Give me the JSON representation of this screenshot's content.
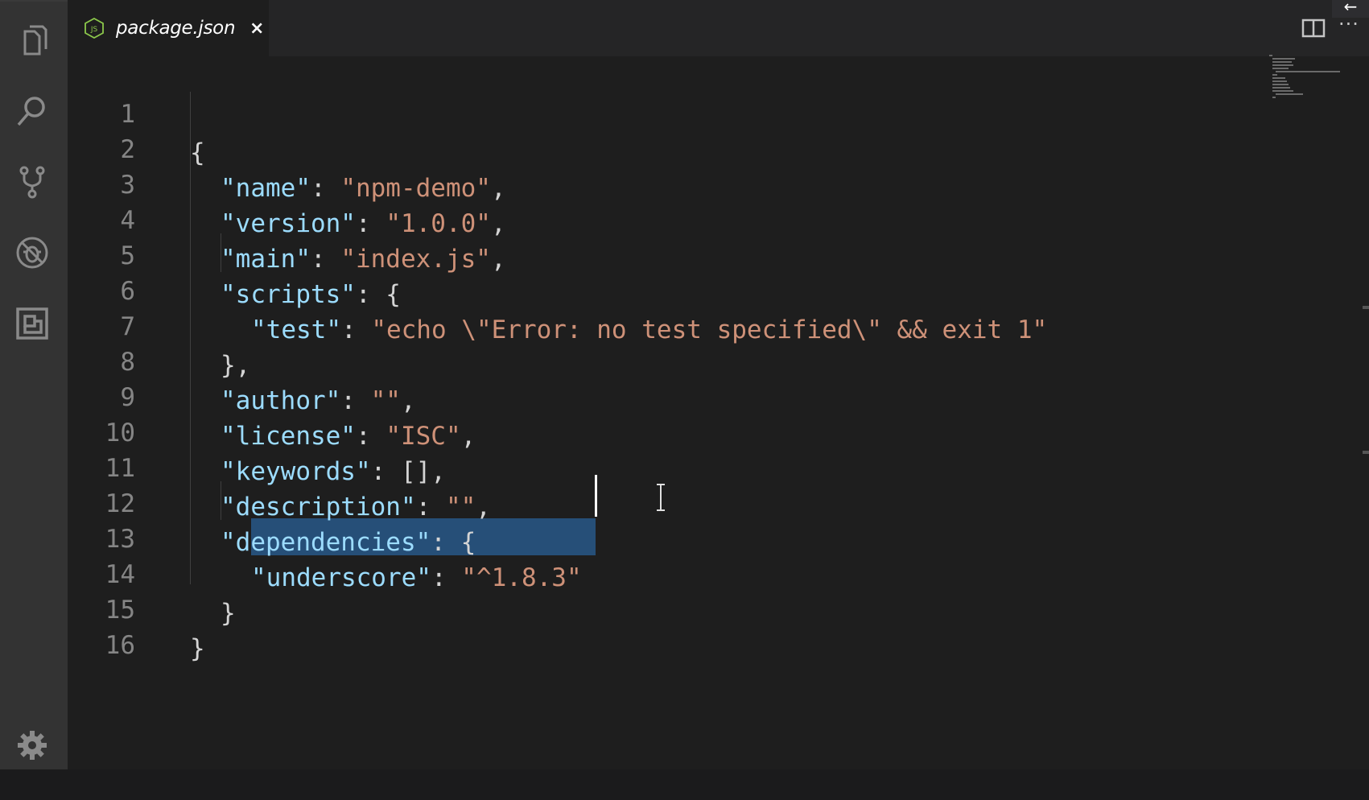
{
  "activity_bar": {
    "icons": [
      "files-icon",
      "search-icon",
      "source-control-icon",
      "debug-icon",
      "extensions-icon",
      "gear-icon"
    ]
  },
  "tab": {
    "label": "package.json",
    "close": "×"
  },
  "editor": {
    "more_actions": "···",
    "back": "←",
    "lines": [
      {
        "n": "1"
      },
      {
        "n": "2"
      },
      {
        "n": "3"
      },
      {
        "n": "4"
      },
      {
        "n": "5"
      },
      {
        "n": "6"
      },
      {
        "n": "7"
      },
      {
        "n": "8"
      },
      {
        "n": "9"
      },
      {
        "n": "10"
      },
      {
        "n": "11"
      },
      {
        "n": "12"
      },
      {
        "n": "13"
      },
      {
        "n": "14"
      },
      {
        "n": "15"
      },
      {
        "n": "16"
      }
    ],
    "tokens": {
      "l1_brace": "{",
      "name_key": "\"name\"",
      "name_val": "\"npm-demo\"",
      "version_key": "\"version\"",
      "version_val": "\"1.0.0\"",
      "main_key": "\"main\"",
      "main_val": "\"index.js\"",
      "scripts_key": "\"scripts\"",
      "test_key": "\"test\"",
      "test_val": "\"echo \\\"Error: no test specified\\\" && exit 1\"",
      "scripts_close": "},",
      "author_key": "\"author\"",
      "author_val": "\"\"",
      "license_key": "\"license\"",
      "license_val": "\"ISC\"",
      "keywords_key": "\"keywords\"",
      "keywords_val": "[]",
      "description_key": "\"description\"",
      "description_val": "\"\"",
      "dependencies_key": "\"dependencies\"",
      "underscore_key": "\"underscore\"",
      "underscore_val": "\"^1.8.3\"",
      "deps_close": "}",
      "root_close": "}"
    }
  },
  "colors": {
    "background": "#1e1e1e",
    "activity_bar": "#333333",
    "key": "#9cdcfe",
    "string": "#ce9178",
    "selection": "#264f78"
  }
}
